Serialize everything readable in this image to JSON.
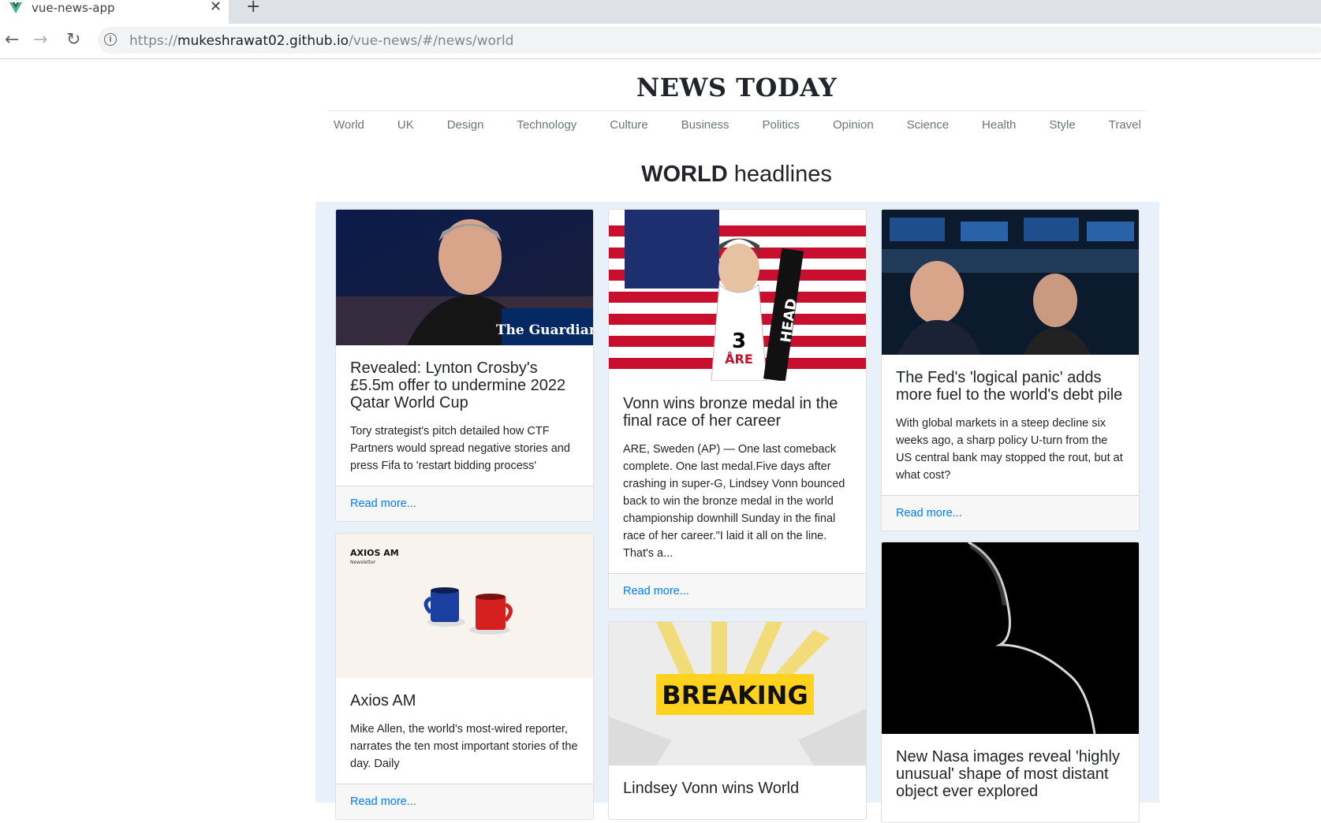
{
  "browser": {
    "tab_title": "vue-news-app",
    "tab_close": "✕",
    "new_tab": "+",
    "url_prefix": "https://",
    "url_host": "mukeshrawat02.github.io",
    "url_path": "/vue-news/#/news/world",
    "back": "←",
    "forward": "→",
    "reload": "↻"
  },
  "site": {
    "brand": "NEWS TODAY",
    "nav": [
      "World",
      "UK",
      "Design",
      "Technology",
      "Culture",
      "Business",
      "Politics",
      "Opinion",
      "Science",
      "Health",
      "Style",
      "Travel"
    ],
    "headline_bold": "WORLD",
    "headline_rest": " headlines"
  },
  "cards": [
    {
      "title": "Revealed: Lynton Crosby's £5.5m offer to undermine 2022 Qatar World Cup",
      "text": "Tory strategist's pitch detailed how CTF Partners would spread negative stories and press Fifa to 'restart bidding process'",
      "link": "Read more...",
      "image_watermark": "The Guardian"
    },
    {
      "title": "Vonn wins bronze medal in the final race of her career",
      "text": "ARE, Sweden (AP) — One last comeback complete. One last medal.Five days after crashing in super-G, Lindsey Vonn bounced back to win the bronze medal in the world championship downhill Sunday in the final race of her career.\"I laid it all on the line. That's a...",
      "link": "Read more...",
      "image_bib": "3",
      "image_bib_place": "ÅRE",
      "image_ski": "HEAD"
    },
    {
      "title": "The Fed's 'logical panic' adds more fuel to the world's debt pile",
      "text": "With global markets in a steep decline six weeks ago, a sharp policy U-turn from the US central bank may stopped the rout, but at what cost?",
      "link": "Read more..."
    },
    {
      "title": "Axios AM",
      "text": "Mike Allen, the world's most-wired reporter, narrates the ten most important stories of the day. Daily",
      "link": "Read more...",
      "image_logo": "AXIOS AM",
      "image_sub": "Newsletter"
    },
    {
      "title": "Lindsey Vonn wins World",
      "text": "",
      "link": "",
      "image_label": "BREAKING"
    },
    {
      "title": "New Nasa images reveal 'highly unusual' shape of most distant object ever explored",
      "text": "",
      "link": ""
    }
  ]
}
